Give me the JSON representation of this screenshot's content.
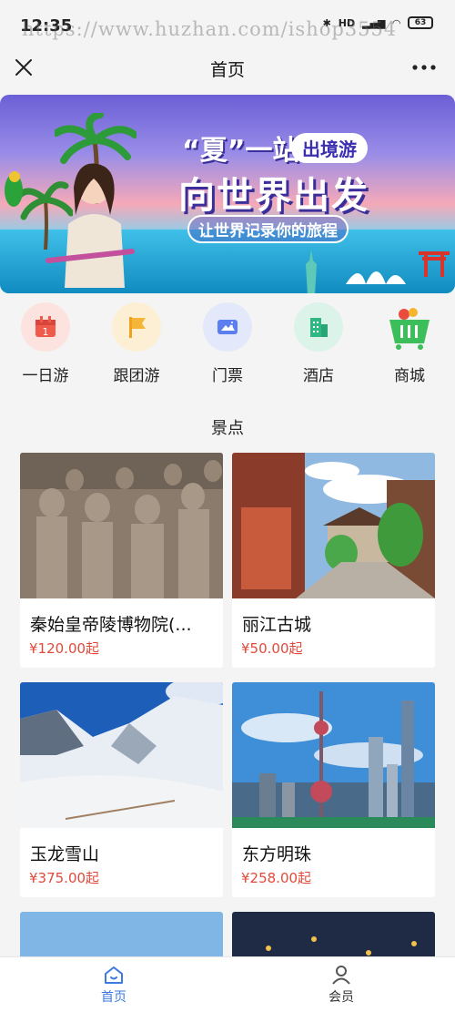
{
  "status": {
    "time": "12:35",
    "signal": "HD",
    "battery": "63"
  },
  "watermark": "https://www.huzhan.com/ishop3554",
  "nav": {
    "title": "首页",
    "close_icon": "close-icon",
    "more_icon": "more-dots-icon"
  },
  "banner": {
    "headline_prefix": "“夏”一站",
    "tag": "出境游",
    "headline": "向世界出发",
    "subline": "让世界记录你的旅程"
  },
  "categories": [
    {
      "label": "一日游",
      "icon": "calendar-icon",
      "bg": "#fde3df",
      "color": "#ef5a4a"
    },
    {
      "label": "跟团游",
      "icon": "flag-icon",
      "bg": "#fdefd4",
      "color": "#f5a623"
    },
    {
      "label": "门票",
      "icon": "ticket-icon",
      "bg": "#e3e9fb",
      "color": "#5b7ff0"
    },
    {
      "label": "酒店",
      "icon": "hotel-icon",
      "bg": "#dcf3ea",
      "color": "#2fb883"
    },
    {
      "label": "商城",
      "icon": "basket-icon",
      "bg": "#f4f4f4",
      "color": "#3cbf5b"
    }
  ],
  "section_title": "景点",
  "attractions": [
    {
      "name": "秦始皇帝陵博物院(...",
      "price": "¥120.00起"
    },
    {
      "name": "丽江古城",
      "price": "¥50.00起"
    },
    {
      "name": "玉龙雪山",
      "price": "¥375.00起"
    },
    {
      "name": "东方明珠",
      "price": "¥258.00起"
    }
  ],
  "tabs": [
    {
      "label": "首页",
      "active": true
    },
    {
      "label": "会员",
      "active": false
    }
  ],
  "colors": {
    "accent": "#3d7be0",
    "price": "#e14a3a"
  }
}
